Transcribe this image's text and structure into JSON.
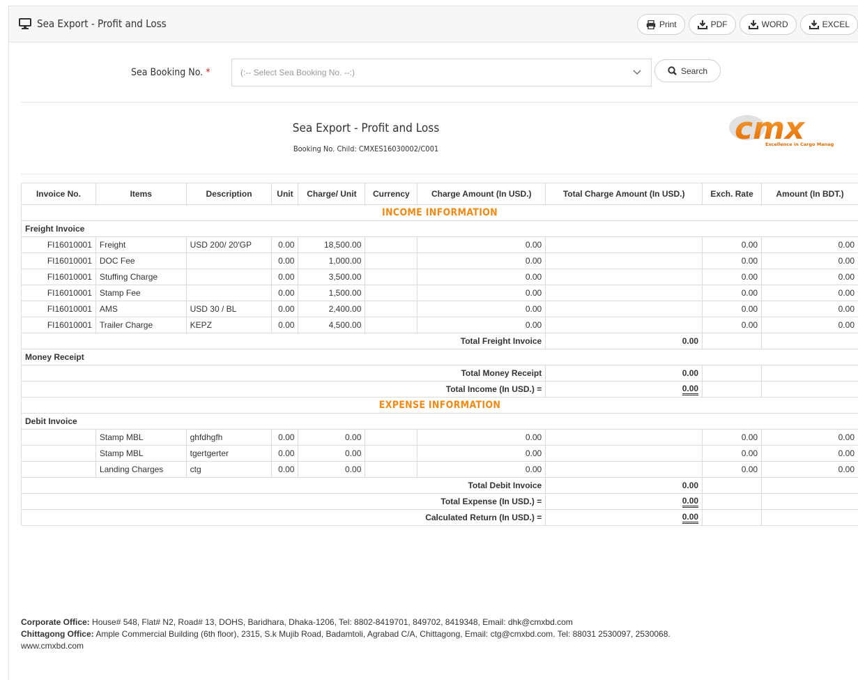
{
  "header": {
    "title": "Sea Export - Profit and Loss",
    "buttons": [
      {
        "label": "Print",
        "icon": "print-icon"
      },
      {
        "label": "PDF",
        "icon": "download-icon"
      },
      {
        "label": "WORD",
        "icon": "download-icon"
      },
      {
        "label": "EXCEL",
        "icon": "download-icon"
      }
    ]
  },
  "search": {
    "label": "Sea Booking No.",
    "required_mark": "*",
    "placeholder": "(:-- Select Sea Booking No. --:)",
    "button_label": "Search"
  },
  "report": {
    "title": "Sea Export - Profit and Loss",
    "subtitle": "Booking No. Child: CMXES16030002/C001",
    "logo_text": "cmx",
    "logo_tagline": "Excellence in Cargo Management"
  },
  "table": {
    "columns": [
      "Invoice No.",
      "Items",
      "Description",
      "Unit",
      "Charge/ Unit",
      "Currency",
      "Charge Amount (In USD.)",
      "Total Charge Amount (In USD.)",
      "Exch. Rate",
      "Amount (In BDT.)"
    ],
    "income_heading": "INCOME INFORMATION",
    "freight_group": "Freight Invoice",
    "freight_rows": [
      {
        "invoice": "FI16010001",
        "item": "Freight",
        "desc": "USD 200/ 20'GP",
        "unit": "0.00",
        "charge_unit": "18,500.00",
        "currency": "",
        "charge_amount": "0.00",
        "total_charge": "",
        "exch": "0.00",
        "bdt": "0.00"
      },
      {
        "invoice": "FI16010001",
        "item": "DOC Fee",
        "desc": "",
        "unit": "0.00",
        "charge_unit": "1,000.00",
        "currency": "",
        "charge_amount": "0.00",
        "total_charge": "",
        "exch": "0.00",
        "bdt": "0.00"
      },
      {
        "invoice": "FI16010001",
        "item": "Stuffing Charge",
        "desc": "",
        "unit": "0.00",
        "charge_unit": "3,500.00",
        "currency": "",
        "charge_amount": "0.00",
        "total_charge": "",
        "exch": "0.00",
        "bdt": "0.00"
      },
      {
        "invoice": "FI16010001",
        "item": "Stamp Fee",
        "desc": "",
        "unit": "0.00",
        "charge_unit": "1,500.00",
        "currency": "",
        "charge_amount": "0.00",
        "total_charge": "",
        "exch": "0.00",
        "bdt": "0.00"
      },
      {
        "invoice": "FI16010001",
        "item": "AMS",
        "desc": "USD 30 / BL",
        "unit": "0.00",
        "charge_unit": "2,400.00",
        "currency": "",
        "charge_amount": "0.00",
        "total_charge": "",
        "exch": "0.00",
        "bdt": "0.00"
      },
      {
        "invoice": "FI16010001",
        "item": "Trailer Charge",
        "desc": "KEPZ",
        "unit": "0.00",
        "charge_unit": "4,500.00",
        "currency": "",
        "charge_amount": "0.00",
        "total_charge": "",
        "exch": "0.00",
        "bdt": "0.00"
      }
    ],
    "total_freight_label": "Total Freight Invoice",
    "total_freight_value": "0.00",
    "money_group": "Money Receipt",
    "total_money_label": "Total Money Receipt",
    "total_money_value": "0.00",
    "total_income_label": "Total Income (In USD.) =",
    "total_income_value": "0.00",
    "expense_heading": "EXPENSE INFORMATION",
    "debit_group": "Debit Invoice",
    "debit_rows": [
      {
        "invoice": "",
        "item": "Stamp MBL",
        "desc": "ghfdhgfh",
        "unit": "0.00",
        "charge_unit": "0.00",
        "currency": "",
        "charge_amount": "0.00",
        "total_charge": "",
        "exch": "0.00",
        "bdt": "0.00"
      },
      {
        "invoice": "",
        "item": "Stamp MBL",
        "desc": "tgertgerter",
        "unit": "0.00",
        "charge_unit": "0.00",
        "currency": "",
        "charge_amount": "0.00",
        "total_charge": "",
        "exch": "0.00",
        "bdt": "0.00"
      },
      {
        "invoice": "",
        "item": "Landing Charges",
        "desc": "ctg",
        "unit": "0.00",
        "charge_unit": "0.00",
        "currency": "",
        "charge_amount": "0.00",
        "total_charge": "",
        "exch": "0.00",
        "bdt": "0.00"
      }
    ],
    "total_debit_label": "Total Debit Invoice",
    "total_debit_value": "0.00",
    "total_expense_label": "Total Expense (In USD.) =",
    "total_expense_value": "0.00",
    "return_label": "Calculated Return (In USD.) =",
    "return_value": "0.00"
  },
  "footer": {
    "corporate_label": "Corporate Office:",
    "corporate_text": "House# 548, Flat# N2, Road# 13, DOHS, Baridhara, Dhaka-1206, Tel: 8802-8419701, 849702, 8419348, Email: dhk@cmxbd.com",
    "chittagong_label": "Chittagong Office:",
    "chittagong_text": "Ample Commercial Building (6th floor), 2315, S.k Mujib Road, Badamtoli, Agrabad C/A, Chittagong, Email: ctg@cmxbd.com. Tel: 88031 2530097, 2530068.",
    "website": "www.cmxbd.com"
  },
  "colors": {
    "accent_orange": "#f08a16",
    "required_red": "#e02020",
    "border": "#dcdcdc"
  }
}
